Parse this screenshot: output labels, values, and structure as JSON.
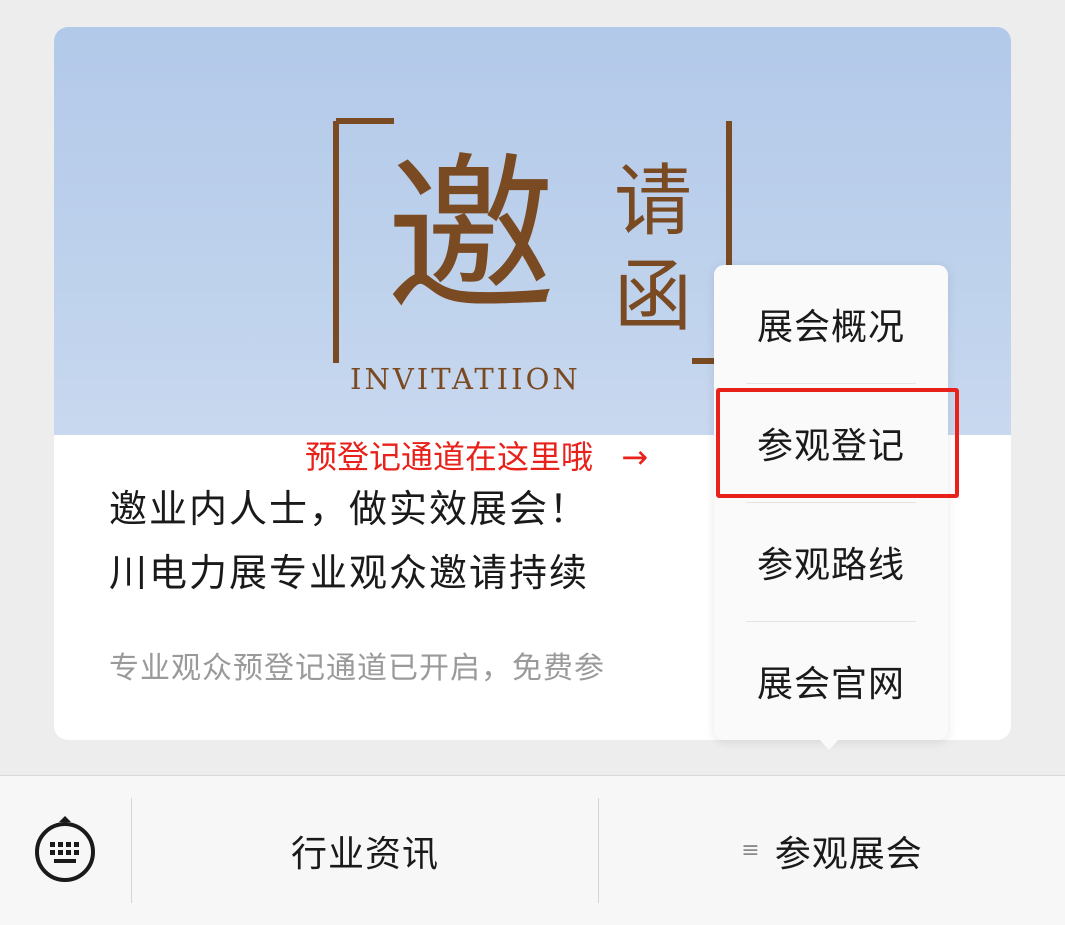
{
  "article": {
    "logo_main_char": "邀",
    "logo_side_chars": [
      "请",
      "函"
    ],
    "logo_english": "INVITATIION",
    "title_line1": "邀业内人士，做实效展会！",
    "title_line2": "川电力展专业观众邀请持续",
    "description": "专业观众预登记通道已开启，免费参"
  },
  "annotation": {
    "text": "预登记通道在这里哦",
    "arrow": "→"
  },
  "popup_menu": {
    "items": [
      {
        "label": "展会概况"
      },
      {
        "label": "参观登记"
      },
      {
        "label": "参观路线"
      },
      {
        "label": "展会官网"
      }
    ],
    "highlighted_index": 1
  },
  "bottom_bar": {
    "keyboard_icon": "keyboard-icon",
    "tab_news": "行业资讯",
    "tab_visit": "参观展会",
    "tab_visit_icon": "≡"
  },
  "colors": {
    "highlight": "#e8221a",
    "logo_brown": "#7a4a22",
    "banner_sky": "#b8cdeb"
  }
}
